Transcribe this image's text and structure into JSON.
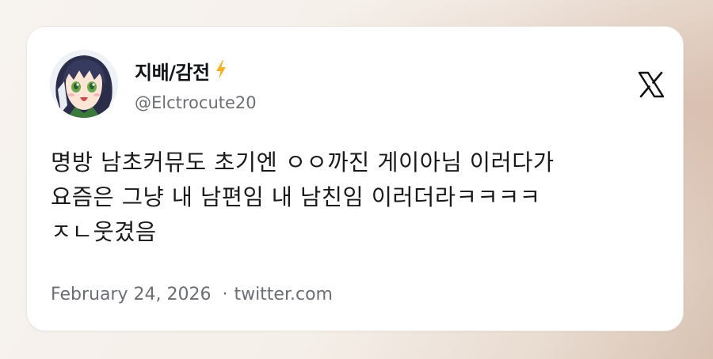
{
  "tweet": {
    "author": {
      "display_name": "지배/감전",
      "handle": "@Elctrocute20",
      "badge_icon": "lightning-bolt-icon"
    },
    "text_lines": [
      "명방 남초커뮤도 초기엔 ㅇㅇ까진 게이아님 이러다가",
      "요즘은 그냥 내 남편임 내 남친임 이러더라ㅋㅋㅋㅋ",
      "ㅈㄴ웃겼음"
    ],
    "date": "February 24, 2026",
    "separator": "·",
    "source": "twitter.com",
    "platform_icon": "x-logo-icon"
  },
  "colors": {
    "name": "#0f1419",
    "secondary": "#6b6f74",
    "bolt": "#f5b025"
  }
}
